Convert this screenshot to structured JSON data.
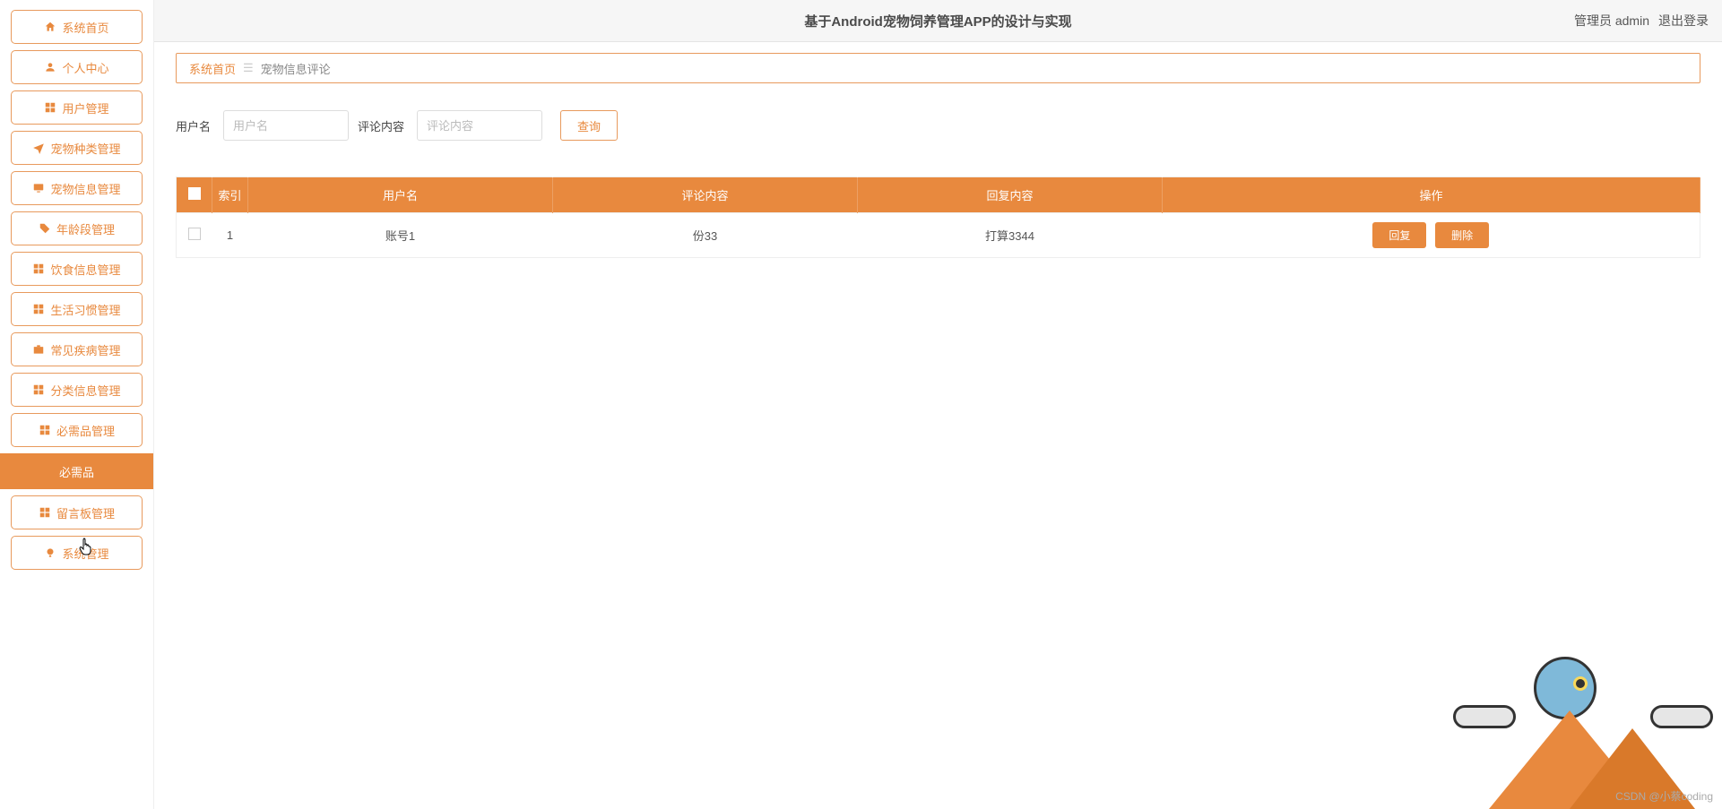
{
  "header": {
    "title": "基于Android宠物饲养管理APP的设计与实现",
    "role_label": "管理员 admin",
    "logout": "退出登录"
  },
  "sidebar": {
    "items": [
      {
        "label": "系统首页",
        "icon": "home"
      },
      {
        "label": "个人中心",
        "icon": "person"
      },
      {
        "label": "用户管理",
        "icon": "grid"
      },
      {
        "label": "宠物种类管理",
        "icon": "plane"
      },
      {
        "label": "宠物信息管理",
        "icon": "monitor"
      },
      {
        "label": "年龄段管理",
        "icon": "tag"
      },
      {
        "label": "饮食信息管理",
        "icon": "grid"
      },
      {
        "label": "生活习惯管理",
        "icon": "grid"
      },
      {
        "label": "常见疾病管理",
        "icon": "briefcase"
      },
      {
        "label": "分类信息管理",
        "icon": "grid"
      },
      {
        "label": "必需品管理",
        "icon": "grid"
      }
    ],
    "active_sub": {
      "label": "必需品"
    },
    "items_after": [
      {
        "label": "留言板管理",
        "icon": "grid"
      },
      {
        "label": "系统管理",
        "icon": "bulb"
      }
    ]
  },
  "breadcrumb": {
    "home": "系统首页",
    "current": "宠物信息评论"
  },
  "filter": {
    "username_label": "用户名",
    "username_placeholder": "用户名",
    "content_label": "评论内容",
    "content_placeholder": "评论内容",
    "search": "查询"
  },
  "table": {
    "headers": {
      "index": "索引",
      "username": "用户名",
      "comment": "评论内容",
      "reply": "回复内容",
      "op": "操作"
    },
    "rows": [
      {
        "index": "1",
        "username": "账号1",
        "comment": "份33",
        "reply": "打算3344"
      }
    ],
    "btn_reply": "回复",
    "btn_delete": "删除"
  },
  "watermark": "CSDN @小蔡coding"
}
